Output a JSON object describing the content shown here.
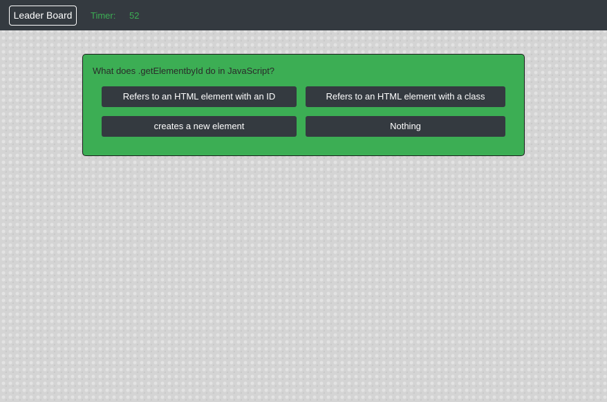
{
  "header": {
    "leaderboard_label": "Leader Board",
    "timer_label": "Timer:",
    "timer_value": "52"
  },
  "quiz": {
    "question": "What does .getElementbyId do in JavaScript?",
    "answers": [
      "Refers to an HTML element with an ID",
      "Refers to an HTML element with a class",
      "creates a new element",
      "Nothing"
    ]
  },
  "colors": {
    "navbar": "#343a40",
    "accent_green": "#3cae54",
    "answer_button": "#343a40",
    "page_background": "#d4d4d4"
  }
}
